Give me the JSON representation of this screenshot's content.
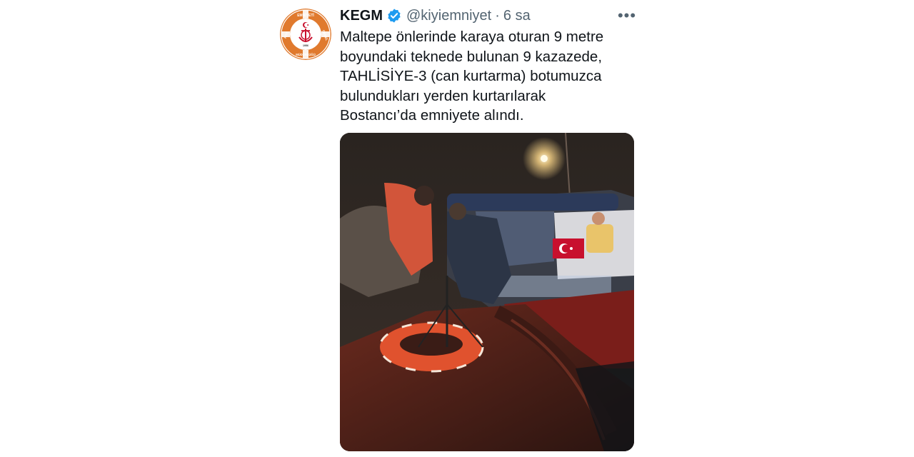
{
  "tweet": {
    "author": {
      "name": "KEGM",
      "handle": "@kiyiemniyet",
      "verified_icon": "verified-badge-icon",
      "avatar": {
        "icon": "kegm-logo-icon",
        "logo_text_top": "EMNİYETİ",
        "logo_text_left": "KIYI",
        "logo_text_right": "GENEL",
        "logo_text_bottom": "MÜDÜRLÜĞÜ",
        "logo_year": "1956",
        "colors": {
          "ring": "#e07a2e",
          "inner": "#ffffff",
          "emblem": "#c8102e"
        }
      }
    },
    "separator": "·",
    "timestamp": "6 sa",
    "more_icon": "more-options-icon",
    "more_label": "•••",
    "text": "Maltepe önlerinde karaya oturan 9 metre\nboyundaki teknede bulunan 9 kazazede,\nTAHLİSİYE-3 (can kurtarma) botumuzca\nbulundukları yerden kurtarılarak\nBostancı’da emniyete alındı.",
    "media": {
      "type": "photo",
      "subject": "night-rescue-boat-photo"
    },
    "colors": {
      "text_primary": "#0f1419",
      "text_secondary": "#536471",
      "verified_blue": "#1d9bf0"
    }
  }
}
